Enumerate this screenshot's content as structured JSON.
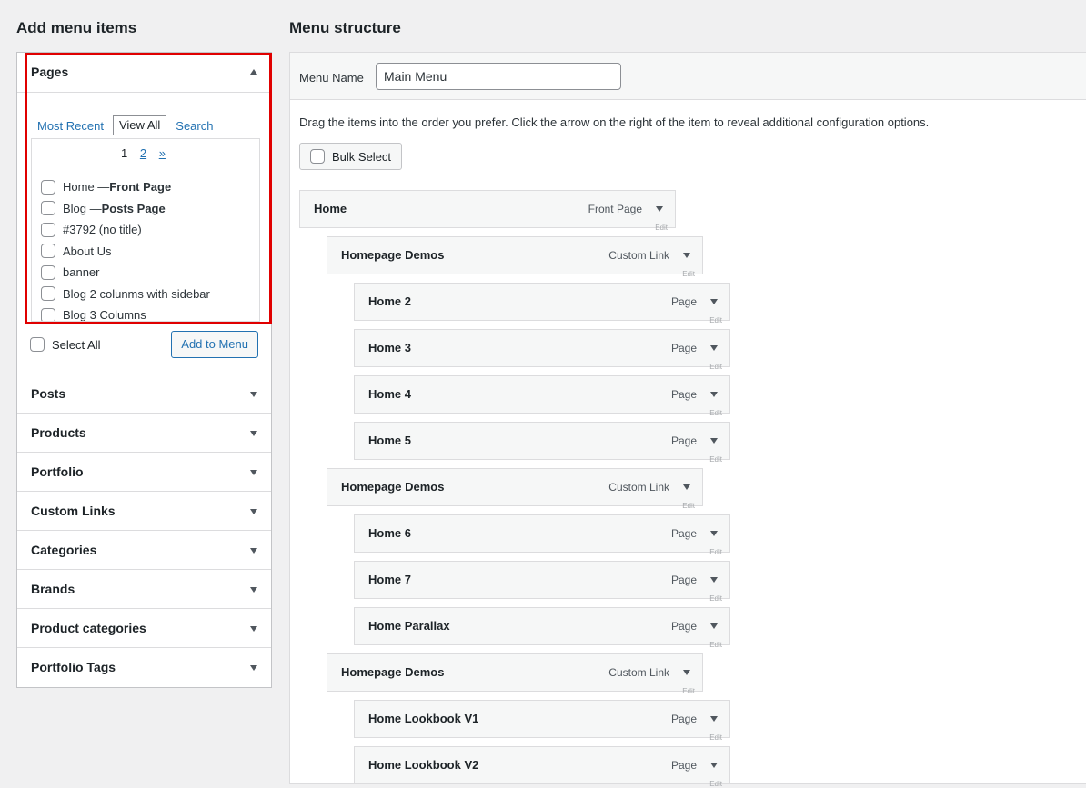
{
  "left": {
    "heading": "Add menu items",
    "pages": {
      "title": "Pages",
      "tabs": [
        "Most Recent",
        "View All",
        "Search"
      ],
      "pager": {
        "current": "1",
        "next_page": "2",
        "next": "»"
      },
      "items": [
        {
          "label": "Home — ",
          "bold": "Front Page"
        },
        {
          "label": "Blog — ",
          "bold": "Posts Page"
        },
        {
          "label": "#3792 (no title)",
          "bold": ""
        },
        {
          "label": "About Us",
          "bold": ""
        },
        {
          "label": "banner",
          "bold": ""
        },
        {
          "label": "Blog 2 colunms with sidebar",
          "bold": ""
        },
        {
          "label": "Blog 3 Columns",
          "bold": ""
        }
      ],
      "select_all": "Select All",
      "add_button": "Add to Menu"
    },
    "sections": [
      "Posts",
      "Products",
      "Portfolio",
      "Custom Links",
      "Categories",
      "Brands",
      "Product categories",
      "Portfolio Tags"
    ]
  },
  "right": {
    "heading": "Menu structure",
    "menu_name_label": "Menu Name",
    "menu_name_value": "Main Menu",
    "instructions": "Drag the items into the order you prefer. Click the arrow on the right of the item to reveal additional configuration options.",
    "bulk_select": "Bulk Select",
    "edit_label": "Edit",
    "items": [
      {
        "title": "Home",
        "type": "Front Page",
        "depth": 0
      },
      {
        "title": "Homepage Demos",
        "type": "Custom Link",
        "depth": 1
      },
      {
        "title": "Home 2",
        "type": "Page",
        "depth": 2
      },
      {
        "title": "Home 3",
        "type": "Page",
        "depth": 2
      },
      {
        "title": "Home 4",
        "type": "Page",
        "depth": 2
      },
      {
        "title": "Home 5",
        "type": "Page",
        "depth": 2
      },
      {
        "title": "Homepage Demos",
        "type": "Custom Link",
        "depth": 1
      },
      {
        "title": "Home 6",
        "type": "Page",
        "depth": 2
      },
      {
        "title": "Home 7",
        "type": "Page",
        "depth": 2
      },
      {
        "title": "Home Parallax",
        "type": "Page",
        "depth": 2
      },
      {
        "title": "Homepage Demos",
        "type": "Custom Link",
        "depth": 1
      },
      {
        "title": "Home Lookbook V1",
        "type": "Page",
        "depth": 2
      },
      {
        "title": "Home Lookbook V2",
        "type": "Page",
        "depth": 2
      }
    ]
  },
  "highlight_color": "#e00000"
}
